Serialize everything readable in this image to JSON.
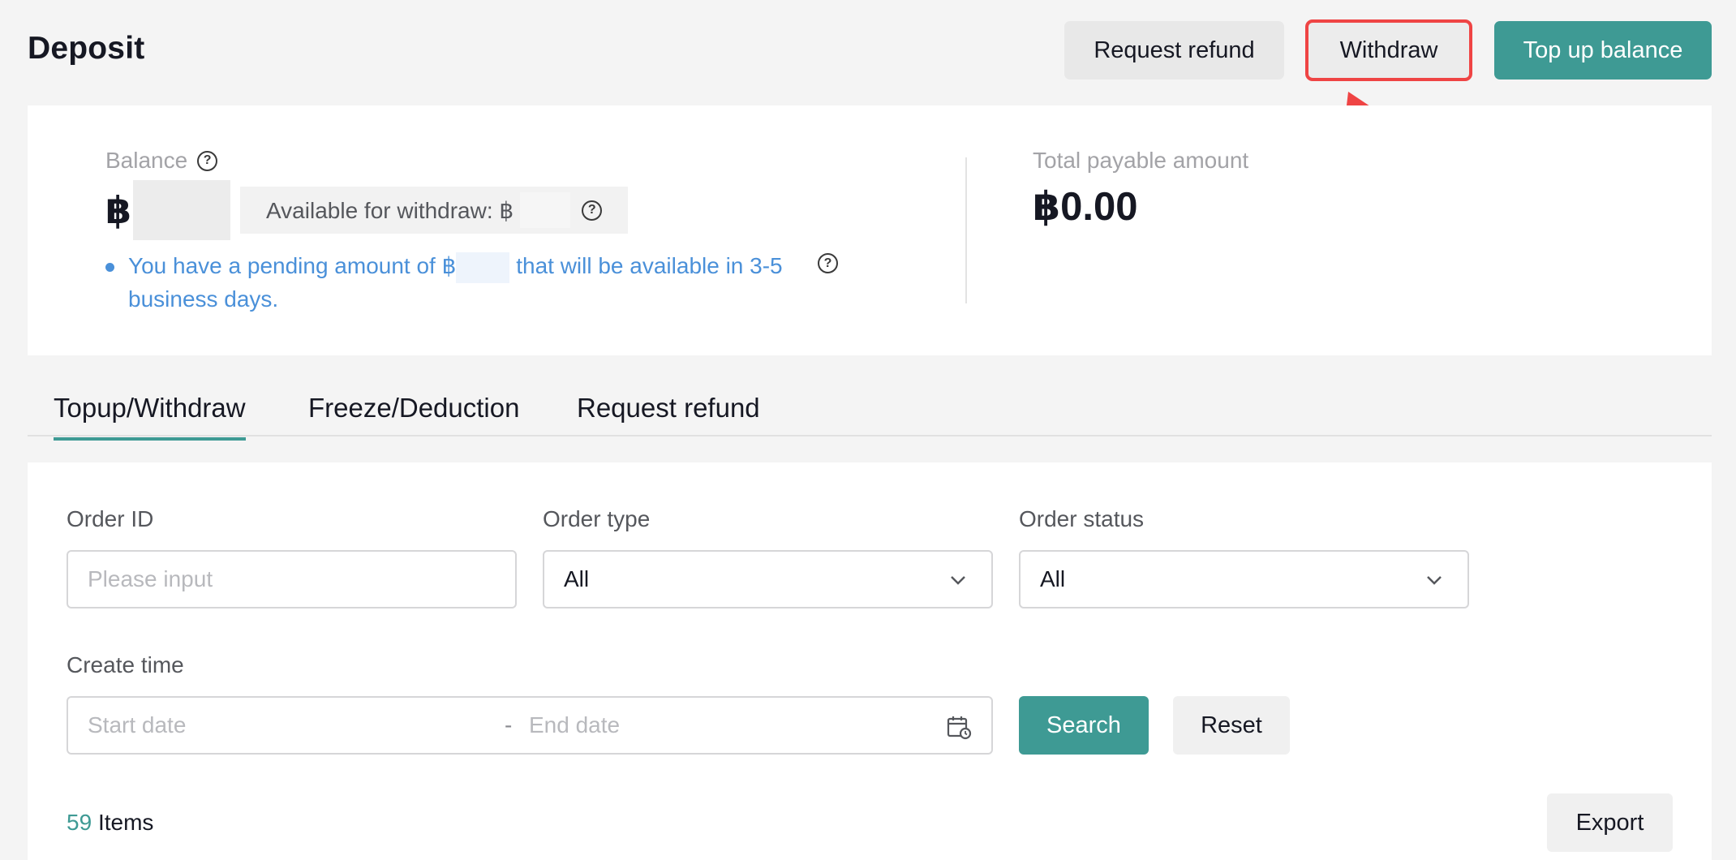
{
  "header": {
    "title": "Deposit",
    "request_refund_label": "Request refund",
    "withdraw_label": "Withdraw",
    "top_up_label": "Top up balance"
  },
  "balance": {
    "label": "Balance",
    "currency_symbol": "฿",
    "available_label": "Available for withdraw: ฿",
    "pending_prefix": "You have a pending amount of ฿",
    "pending_suffix": "that will be available in 3-5 business days."
  },
  "payable": {
    "label": "Total payable amount",
    "value": "฿0.00"
  },
  "tabs": [
    {
      "label": "Topup/Withdraw",
      "active": true
    },
    {
      "label": "Freeze/Deduction",
      "active": false
    },
    {
      "label": "Request refund",
      "active": false
    }
  ],
  "filters": {
    "order_id": {
      "label": "Order ID",
      "placeholder": "Please input"
    },
    "order_type": {
      "label": "Order type",
      "value": "All"
    },
    "order_status": {
      "label": "Order status",
      "value": "All"
    },
    "create_time": {
      "label": "Create time",
      "start_placeholder": "Start date",
      "separator": "-",
      "end_placeholder": "End date"
    },
    "search_label": "Search",
    "reset_label": "Reset"
  },
  "results": {
    "count": "59",
    "count_suffix": "Items",
    "export_label": "Export"
  },
  "colors": {
    "accent": "#3e9a94",
    "highlight": "#ef4444",
    "link": "#4a90d9"
  },
  "icons": {
    "help": "help-circle-icon",
    "dropdown": "chevron-down-icon",
    "calendar": "calendar-icon"
  }
}
